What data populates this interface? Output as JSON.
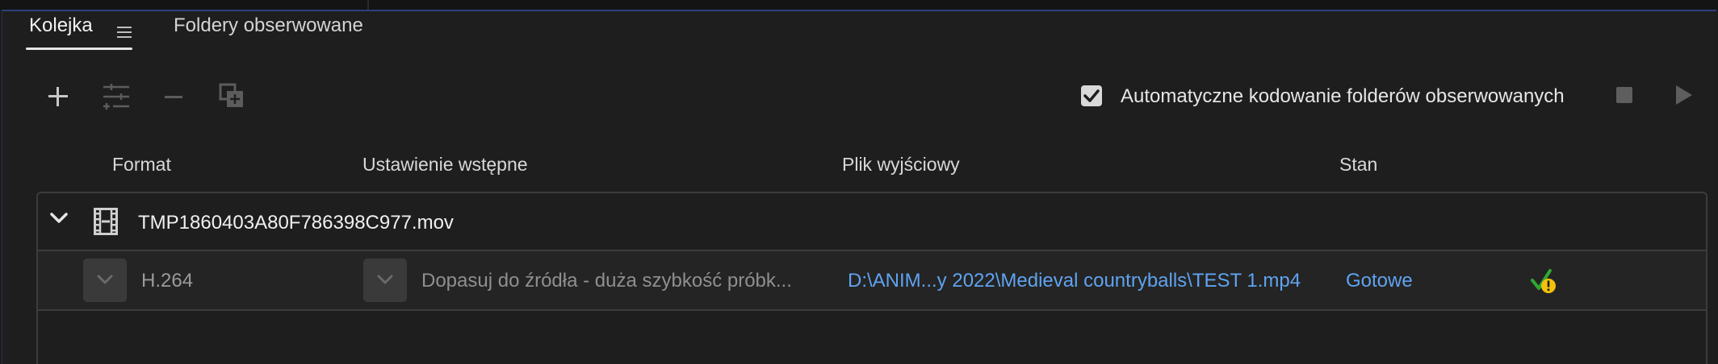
{
  "tabs": {
    "queue_label": "Kolejka",
    "watch_folders_label": "Foldery obserwowane"
  },
  "toolbar": {
    "add_icon": "plus-icon",
    "settings_icon": "preset-settings-icon",
    "remove_icon": "minus-icon",
    "duplicate_icon": "duplicate-icon",
    "auto_encode_label": "Automatyczne kodowanie folderów obserwowanych",
    "auto_encode_checked": true,
    "stop_icon": "stop-icon",
    "start_icon": "play-icon"
  },
  "columns": {
    "format": "Format",
    "preset": "Ustawienie wstępne",
    "output": "Plik wyjściowy",
    "status": "Stan"
  },
  "queue": {
    "source_name": "TMP1860403A80F786398C977.mov",
    "items": [
      {
        "format": "H.264",
        "preset": "Dopasuj do źródła - duża szybkość próbk...",
        "output": "D:\\ANIM...y 2022\\Medieval countryballs\\TEST 1.mp4",
        "status": "Gotowe",
        "status_icon": "ready-with-warning-icon"
      }
    ]
  },
  "colors": {
    "background": "#1e1e1e",
    "link": "#5fa3f0",
    "accent_border": "#2e3f7a"
  }
}
